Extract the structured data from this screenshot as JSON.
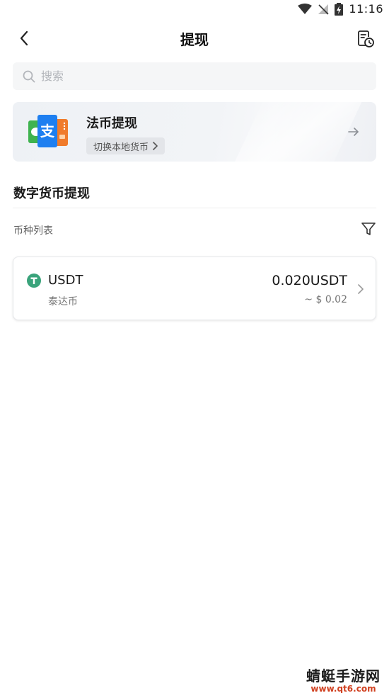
{
  "status_bar": {
    "time": "11:16"
  },
  "header": {
    "title": "提现"
  },
  "search": {
    "placeholder": "搜索"
  },
  "fiat": {
    "title": "法币提现",
    "switch_label": "切换本地货币"
  },
  "digital": {
    "section_title": "数字货币提现",
    "list_label": "币种列表"
  },
  "coins": [
    {
      "symbol": "USDT",
      "name": "泰达币",
      "amount": "0.020USDT",
      "value": "~ $ 0.02",
      "icon_color": "#3aa37b"
    }
  ],
  "watermark": {
    "title": "蜻蜓手游网",
    "url": "www.qt6.com"
  },
  "colors": {
    "accent": "#3aa37b",
    "card_bg": "#eef1f5"
  }
}
